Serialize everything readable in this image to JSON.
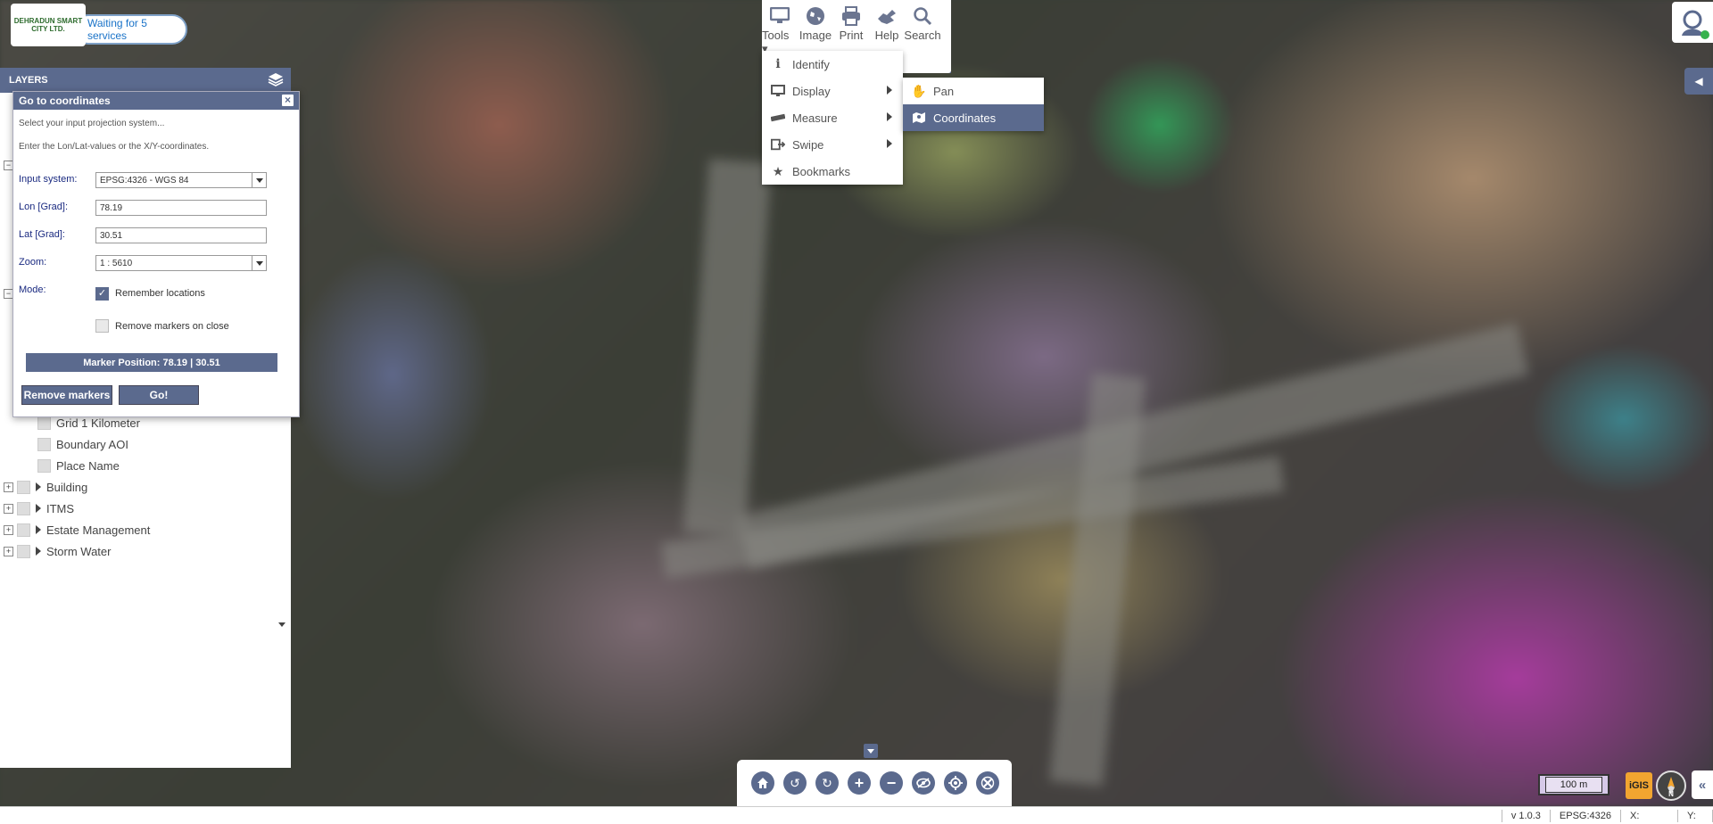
{
  "app": {
    "logo_text": "DEHRADUN SMART CITY LTD.",
    "status_message": "Waiting for 5 services"
  },
  "toolbar": {
    "items": [
      {
        "label": "Tools",
        "icon": "monitor-icon"
      },
      {
        "label": "Image",
        "icon": "globe-icon"
      },
      {
        "label": "Print",
        "icon": "printer-icon"
      },
      {
        "label": "Help",
        "icon": "help-icon"
      },
      {
        "label": "Search",
        "icon": "search-icon"
      }
    ]
  },
  "tools_menu": {
    "items": [
      {
        "label": "Identify",
        "icon": "info-icon",
        "submenu": false
      },
      {
        "label": "Display",
        "icon": "display-icon",
        "submenu": true
      },
      {
        "label": "Measure",
        "icon": "ruler-icon",
        "submenu": true
      },
      {
        "label": "Swipe",
        "icon": "swipe-icon",
        "submenu": true
      },
      {
        "label": "Bookmarks",
        "icon": "star-icon",
        "submenu": false
      }
    ],
    "display_submenu": [
      {
        "label": "Pan",
        "icon": "hand-icon",
        "active": false
      },
      {
        "label": "Coordinates",
        "icon": "map-pin-icon",
        "active": true
      }
    ]
  },
  "layers": {
    "title": "LAYERS",
    "visible_rows": [
      {
        "label": "Grid 1 Kilometer",
        "type": "child"
      },
      {
        "label": "Boundary AOI",
        "type": "child"
      },
      {
        "label": "Place Name",
        "type": "child"
      },
      {
        "label": "Building",
        "type": "group"
      },
      {
        "label": "ITMS",
        "type": "group"
      },
      {
        "label": "Estate Management",
        "type": "group"
      },
      {
        "label": "Storm Water",
        "type": "group"
      }
    ]
  },
  "goto_dialog": {
    "title": "Go to coordinates",
    "close_label": "×",
    "hint_projection": "Select your input projection system...",
    "hint_values": "Enter the Lon/Lat-values or the X/Y-coordinates.",
    "input_system_label": "Input system:",
    "input_system_value": "EPSG:4326 - WGS 84",
    "lon_label": "Lon [Grad]:",
    "lon_value": "78.19",
    "lat_label": "Lat [Grad]:",
    "lat_value": "30.51",
    "zoom_label": "Zoom:",
    "zoom_value": "1 : 5610",
    "mode_label": "Mode:",
    "remember_label": "Remember locations",
    "remember_checked": true,
    "remove_on_close_label": "Remove markers on close",
    "remove_on_close_checked": false,
    "marker_position": "Marker Position: 78.19 | 30.51",
    "remove_markers_button": "Remove markers",
    "go_button": "Go!"
  },
  "map": {
    "scale_label": "100 m",
    "igis_label": "iGIS",
    "compass_label": "N"
  },
  "navbar": {
    "buttons": [
      "home-icon",
      "undo-icon",
      "redo-icon",
      "zoom-in-icon",
      "zoom-out-icon",
      "hide-icon",
      "locate-icon",
      "clear-icon"
    ]
  },
  "statusbar": {
    "version": "v 1.0.3",
    "projection": "EPSG:4326",
    "x_label": "X:",
    "y_label": "Y:"
  },
  "colors": {
    "accent": "#5b6a8e",
    "status_text": "#1a73c8"
  }
}
